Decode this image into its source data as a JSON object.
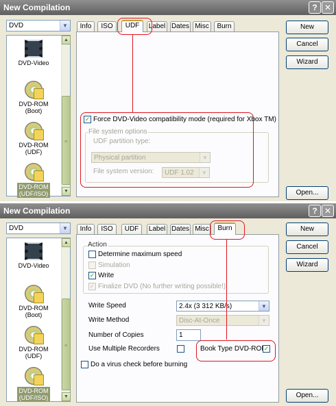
{
  "top_window": {
    "title": "New Compilation",
    "help_glyph": "?",
    "close_glyph": "✕",
    "disc_type": "DVD",
    "list_items": [
      {
        "label": "DVD-Video"
      },
      {
        "label": "DVD-ROM (Boot)"
      },
      {
        "label": "DVD-ROM (UDF)"
      },
      {
        "label": "DVD-ROM (UDF/ISO)"
      }
    ],
    "tabs": [
      "Info",
      "ISO",
      "UDF",
      "Label",
      "Dates",
      "Misc",
      "Burn"
    ],
    "active_tab": "UDF",
    "force_dvd_video": "Force DVD-Video compatibility mode (required for Xbox TM)",
    "fs_options_title": "File system options",
    "udf_partition_label": "UDF partition type:",
    "udf_partition_value": "Physical partition",
    "fs_version_label": "File system version:",
    "fs_version_value": "UDF 1.02",
    "buttons": {
      "new": "New",
      "cancel": "Cancel",
      "wizard": "Wizard",
      "open": "Open..."
    }
  },
  "bottom_window": {
    "title": "New Compilation",
    "help_glyph": "?",
    "close_glyph": "✕",
    "disc_type": "DVD",
    "list_items": [
      {
        "label": "DVD-Video"
      },
      {
        "label": "DVD-ROM (Boot)"
      },
      {
        "label": "DVD-ROM (UDF)"
      },
      {
        "label": "DVD-ROM (UDF/ISO)"
      }
    ],
    "tabs": [
      "Info",
      "ISO",
      "UDF",
      "Label",
      "Dates",
      "Misc",
      "Burn"
    ],
    "active_tab": "Burn",
    "action_title": "Action",
    "determine_max_speed": "Determine maximum speed",
    "simulation": "Simulation",
    "write": "Write",
    "finalize_dvd": "Finalize DVD (No further writing possible!)",
    "write_speed_label": "Write Speed",
    "write_speed_value": "2.4x (3 312 KB/s)",
    "write_method_label": "Write Method",
    "write_method_value": "Disc-At-Once",
    "copies_label": "Number of Copies",
    "copies_value": "1",
    "multi_recorders_label": "Use Multiple Recorders",
    "book_type_label": "Book Type DVD-ROM",
    "virus_check": "Do a virus check before burning",
    "buttons": {
      "new": "New",
      "cancel": "Cancel",
      "wizard": "Wizard",
      "open": "Open..."
    }
  }
}
